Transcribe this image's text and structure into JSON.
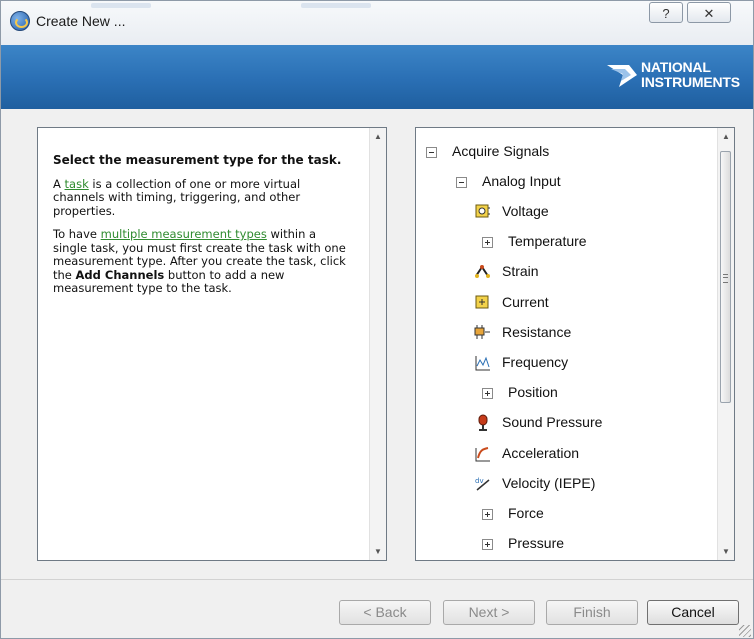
{
  "window": {
    "title": "Create New ...",
    "help_label": "?",
    "close_label": "✕"
  },
  "banner": {
    "brand_line1": "NATIONAL",
    "brand_line2": "INSTRUMENTS"
  },
  "info": {
    "heading": "Select the measurement type for the task.",
    "p1_pre": "A ",
    "p1_link": "task",
    "p1_post": " is a collection of one or more virtual channels with timing, triggering, and other properties.",
    "p2_pre": "To have ",
    "p2_link": "multiple measurement types",
    "p2_mid": " within a single task, you must first create the task with one measurement type. After you create the task, click the ",
    "p2_bold": "Add Channels",
    "p2_post": " button to add a new measurement type to the task."
  },
  "tree": {
    "root": "Acquire Signals",
    "group": "Analog Input",
    "items": [
      {
        "label": "Voltage",
        "icon": "voltage-icon"
      },
      {
        "label": "Temperature",
        "icon": "expand-icon"
      },
      {
        "label": "Strain",
        "icon": "strain-icon"
      },
      {
        "label": "Current",
        "icon": "current-icon"
      },
      {
        "label": "Resistance",
        "icon": "resistance-icon"
      },
      {
        "label": "Frequency",
        "icon": "frequency-icon"
      },
      {
        "label": "Position",
        "icon": "expand-icon"
      },
      {
        "label": "Sound Pressure",
        "icon": "microphone-icon"
      },
      {
        "label": "Acceleration",
        "icon": "acceleration-icon"
      },
      {
        "label": "Velocity (IEPE)",
        "icon": "velocity-icon"
      },
      {
        "label": "Force",
        "icon": "expand-icon"
      },
      {
        "label": "Pressure",
        "icon": "expand-icon"
      }
    ]
  },
  "footer": {
    "back_label": "< Back",
    "next_label": "Next >",
    "finish_label": "Finish",
    "cancel_label": "Cancel"
  },
  "colors": {
    "banner": "#2a6fb4",
    "link": "#2f8b2f"
  }
}
